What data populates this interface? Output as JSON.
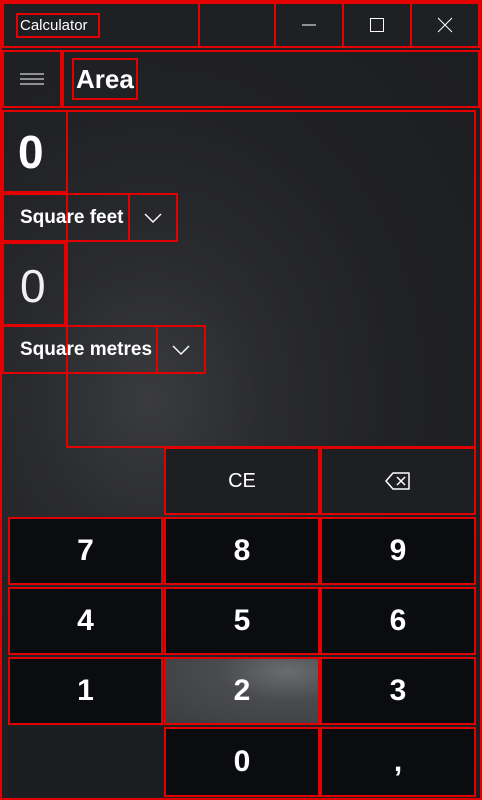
{
  "window": {
    "title": "Calculator"
  },
  "header": {
    "mode": "Area"
  },
  "converter": {
    "from_value": "0",
    "from_unit": "Square feet",
    "to_value": "0",
    "to_unit": "Square metres"
  },
  "keypad": {
    "ce": "CE",
    "k7": "7",
    "k8": "8",
    "k9": "9",
    "k4": "4",
    "k5": "5",
    "k6": "6",
    "k1": "1",
    "k2": "2",
    "k3": "3",
    "k0": "0",
    "decimal": ","
  },
  "icons": {
    "minimize": "minimize-icon",
    "maximize": "maximize-icon",
    "close": "close-icon",
    "menu": "hamburger-icon",
    "chevron": "chevron-down-icon",
    "backspace": "backspace-icon"
  },
  "colors": {
    "background": "#1f2023",
    "key_dark": "#0b0c0f",
    "key_light": "#1e1f22",
    "text": "#ffffff"
  }
}
